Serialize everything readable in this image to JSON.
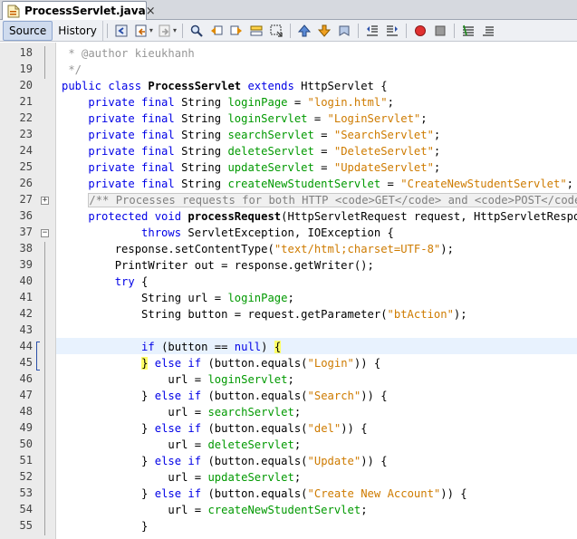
{
  "tab": {
    "title": "ProcessServlet.java",
    "close": "×"
  },
  "toolbar": {
    "source_label": "Source",
    "history_label": "History",
    "icons": [
      "last-edit-icon",
      "back-icon",
      "forward-icon",
      "find-icon",
      "find-previous-icon",
      "find-next-icon",
      "toggle-highlight-icon",
      "toggle-rectangular-selection-icon",
      "previous-bookmark-icon",
      "next-bookmark-icon",
      "toggle-bookmark-icon",
      "shift-left-icon",
      "shift-right-icon",
      "start-macro-icon",
      "stop-macro-icon",
      "comment-icon",
      "uncomment-icon"
    ]
  },
  "gutter": {
    "lines": [
      "18",
      "19",
      "20",
      "21",
      "22",
      "23",
      "24",
      "25",
      "26",
      "27",
      "36",
      "37",
      "38",
      "39",
      "40",
      "41",
      "42",
      "43",
      "44",
      "45",
      "46",
      "47",
      "48",
      "49",
      "50",
      "51",
      "52",
      "53",
      "54",
      "55"
    ]
  },
  "code": [
    [
      {
        "t": " * @author kieukhanh",
        "c": "cmt"
      }
    ],
    [
      {
        "t": " */",
        "c": "cmt"
      }
    ],
    [
      {
        "t": "public class ",
        "c": "kw"
      },
      {
        "t": "ProcessServlet",
        "c": "fnd"
      },
      {
        "t": " ",
        "c": ""
      },
      {
        "t": "extends",
        "c": "kw"
      },
      {
        "t": " HttpServlet {",
        "c": ""
      }
    ],
    [
      {
        "t": "    private final ",
        "c": "kw"
      },
      {
        "t": "String ",
        "c": ""
      },
      {
        "t": "loginPage",
        "c": "fld"
      },
      {
        "t": " = ",
        "c": ""
      },
      {
        "t": "\"login.html\"",
        "c": "str"
      },
      {
        "t": ";",
        "c": ""
      }
    ],
    [
      {
        "t": "    private final ",
        "c": "kw"
      },
      {
        "t": "String ",
        "c": ""
      },
      {
        "t": "loginServlet",
        "c": "fld"
      },
      {
        "t": " = ",
        "c": ""
      },
      {
        "t": "\"LoginServlet\"",
        "c": "str"
      },
      {
        "t": ";",
        "c": ""
      }
    ],
    [
      {
        "t": "    private final ",
        "c": "kw"
      },
      {
        "t": "String ",
        "c": ""
      },
      {
        "t": "searchServlet",
        "c": "fld"
      },
      {
        "t": " = ",
        "c": ""
      },
      {
        "t": "\"SearchServlet\"",
        "c": "str"
      },
      {
        "t": ";",
        "c": ""
      }
    ],
    [
      {
        "t": "    private final ",
        "c": "kw"
      },
      {
        "t": "String ",
        "c": ""
      },
      {
        "t": "deleteServlet",
        "c": "fld"
      },
      {
        "t": " = ",
        "c": ""
      },
      {
        "t": "\"DeleteServlet\"",
        "c": "str"
      },
      {
        "t": ";",
        "c": ""
      }
    ],
    [
      {
        "t": "    private final ",
        "c": "kw"
      },
      {
        "t": "String ",
        "c": ""
      },
      {
        "t": "updateServlet",
        "c": "fld"
      },
      {
        "t": " = ",
        "c": ""
      },
      {
        "t": "\"UpdateServlet\"",
        "c": "str"
      },
      {
        "t": ";",
        "c": ""
      }
    ],
    [
      {
        "t": "    private final ",
        "c": "kw"
      },
      {
        "t": "String ",
        "c": ""
      },
      {
        "t": "createNewStudentServlet",
        "c": "fld"
      },
      {
        "t": " = ",
        "c": ""
      },
      {
        "t": "\"CreateNewStudentServlet\"",
        "c": "str"
      },
      {
        "t": ";",
        "c": ""
      }
    ],
    [
      {
        "t": "    ",
        "c": ""
      },
      {
        "t": "/** Processes requests for both HTTP <code>GET</code> and <code>POST</code> methods.",
        "c": "fold-block cmt"
      }
    ],
    [
      {
        "t": "    protected void ",
        "c": "kw"
      },
      {
        "t": "processRequest",
        "c": "fnd"
      },
      {
        "t": "(HttpServletRequest request, HttpServletResponse response)",
        "c": ""
      }
    ],
    [
      {
        "t": "            throws ",
        "c": "kw"
      },
      {
        "t": "ServletException, IOException {",
        "c": ""
      }
    ],
    [
      {
        "t": "        response.setContentType(",
        "c": ""
      },
      {
        "t": "\"text/html;charset=UTF-8\"",
        "c": "str"
      },
      {
        "t": ");",
        "c": ""
      }
    ],
    [
      {
        "t": "        PrintWriter out = response.getWriter();",
        "c": ""
      }
    ],
    [
      {
        "t": "        try",
        "c": "kw"
      },
      {
        "t": " {",
        "c": ""
      }
    ],
    [
      {
        "t": "            String url = ",
        "c": ""
      },
      {
        "t": "loginPage",
        "c": "fld"
      },
      {
        "t": ";",
        "c": ""
      }
    ],
    [
      {
        "t": "            String button = request.getParameter(",
        "c": ""
      },
      {
        "t": "\"btAction\"",
        "c": "str"
      },
      {
        "t": ");",
        "c": ""
      }
    ],
    [
      {
        "t": "",
        "c": ""
      }
    ],
    [
      {
        "t": "            if",
        "c": "kw"
      },
      {
        "t": " (button == ",
        "c": ""
      },
      {
        "t": "null",
        "c": "kw"
      },
      {
        "t": ") ",
        "c": ""
      },
      {
        "t": "{",
        "c": "brace-match"
      }
    ],
    [
      {
        "t": "            ",
        "c": ""
      },
      {
        "t": "}",
        "c": "brace-match"
      },
      {
        "t": " else if",
        "c": "kw"
      },
      {
        "t": " (button.equals(",
        "c": ""
      },
      {
        "t": "\"Login\"",
        "c": "str"
      },
      {
        "t": ")) {",
        "c": ""
      }
    ],
    [
      {
        "t": "                url = ",
        "c": ""
      },
      {
        "t": "loginServlet",
        "c": "fld"
      },
      {
        "t": ";",
        "c": ""
      }
    ],
    [
      {
        "t": "            } ",
        "c": ""
      },
      {
        "t": "else if",
        "c": "kw"
      },
      {
        "t": " (button.equals(",
        "c": ""
      },
      {
        "t": "\"Search\"",
        "c": "str"
      },
      {
        "t": ")) {",
        "c": ""
      }
    ],
    [
      {
        "t": "                url = ",
        "c": ""
      },
      {
        "t": "searchServlet",
        "c": "fld"
      },
      {
        "t": ";",
        "c": ""
      }
    ],
    [
      {
        "t": "            } ",
        "c": ""
      },
      {
        "t": "else if",
        "c": "kw"
      },
      {
        "t": " (button.equals(",
        "c": ""
      },
      {
        "t": "\"del\"",
        "c": "str"
      },
      {
        "t": ")) {",
        "c": ""
      }
    ],
    [
      {
        "t": "                url = ",
        "c": ""
      },
      {
        "t": "deleteServlet",
        "c": "fld"
      },
      {
        "t": ";",
        "c": ""
      }
    ],
    [
      {
        "t": "            } ",
        "c": ""
      },
      {
        "t": "else if",
        "c": "kw"
      },
      {
        "t": " (button.equals(",
        "c": ""
      },
      {
        "t": "\"Update\"",
        "c": "str"
      },
      {
        "t": ")) {",
        "c": ""
      }
    ],
    [
      {
        "t": "                url = ",
        "c": ""
      },
      {
        "t": "updateServlet",
        "c": "fld"
      },
      {
        "t": ";",
        "c": ""
      }
    ],
    [
      {
        "t": "            } ",
        "c": ""
      },
      {
        "t": "else if",
        "c": "kw"
      },
      {
        "t": " (button.equals(",
        "c": ""
      },
      {
        "t": "\"Create New Account\"",
        "c": "str"
      },
      {
        "t": ")) {",
        "c": ""
      }
    ],
    [
      {
        "t": "                url = ",
        "c": ""
      },
      {
        "t": "createNewStudentServlet",
        "c": "fld"
      },
      {
        "t": ";",
        "c": ""
      }
    ],
    [
      {
        "t": "            }",
        "c": ""
      }
    ]
  ],
  "colors": {
    "keyword": "#0000e6",
    "string": "#ce7b00",
    "field": "#009900",
    "comment": "#969696",
    "current_line": "#e8f2fe",
    "brace_match": "#ffff66"
  }
}
